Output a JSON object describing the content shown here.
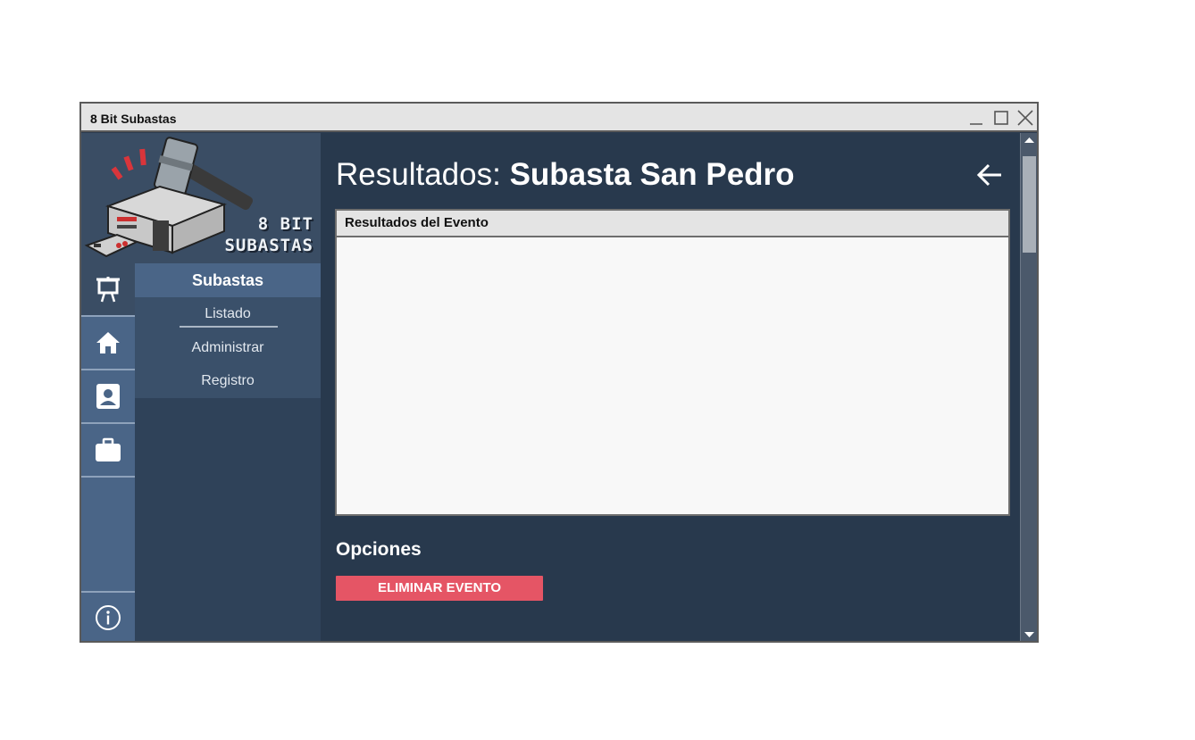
{
  "window": {
    "title": "8 Bit Subastas"
  },
  "logo": {
    "line1": "8 BIT",
    "line2": "SUBASTAS"
  },
  "rail": {
    "items": [
      {
        "icon": "presentation-board-icon",
        "active": true
      },
      {
        "icon": "home-icon",
        "active": false
      },
      {
        "icon": "contact-card-icon",
        "active": false
      },
      {
        "icon": "briefcase-icon",
        "active": false
      }
    ],
    "info_icon": "info-icon"
  },
  "submenu": {
    "header": "Subastas",
    "items": [
      "Listado",
      "Administrar",
      "Registro"
    ],
    "selected": "Listado"
  },
  "page": {
    "title_prefix": "Resultados: ",
    "title_main": "Subasta San Pedro"
  },
  "results_panel": {
    "header": "Resultados del Evento"
  },
  "options": {
    "title": "Opciones",
    "delete_label": "ELIMINAR EVENTO",
    "delete_color": "#e55565"
  },
  "colors": {
    "content_bg": "#28394d",
    "rail_bg": "#4a6587",
    "submenu_bg": "#2f4259"
  }
}
